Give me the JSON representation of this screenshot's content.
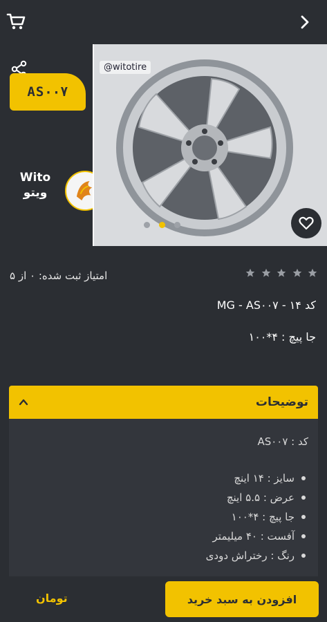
{
  "topbar": {
    "cart_icon": "cart-icon",
    "back_icon": "chevron-right-icon"
  },
  "hero": {
    "badge_code": "AS۰۰۷",
    "logo_text_top": "Wito",
    "logo_text_bottom": "ویتو",
    "photo_label": "@witotire",
    "carousel": {
      "count": 3,
      "active_index": 1
    },
    "favorite_icon": "heart-icon",
    "share_icon": "share-icon"
  },
  "rating": {
    "stars_filled": 0,
    "stars_total": 5,
    "text": "امتیاز ثبت شده: ۰ از ۵"
  },
  "product": {
    "code_line": "کد MG - AS۰۰۷ - ۱۴",
    "bolt_line": "جا پیچ : ۴*۱۰۰"
  },
  "description": {
    "title": "توضیحات",
    "code": "کد : AS۰۰۷",
    "items": [
      "سایز : ۱۴ اینچ",
      "عرض : ۵.۵ اینچ",
      "جا پیچ : ۴*۱۰۰",
      "آفست : ۴۰ میلیمتر",
      "رنگ : رختراش دودی"
    ]
  },
  "bottom": {
    "price": "تومان",
    "add_to_cart": "افزودن به سبد خرید"
  },
  "colors": {
    "accent": "#f2c200",
    "background": "#2b2e33",
    "panel": "#33363c"
  }
}
